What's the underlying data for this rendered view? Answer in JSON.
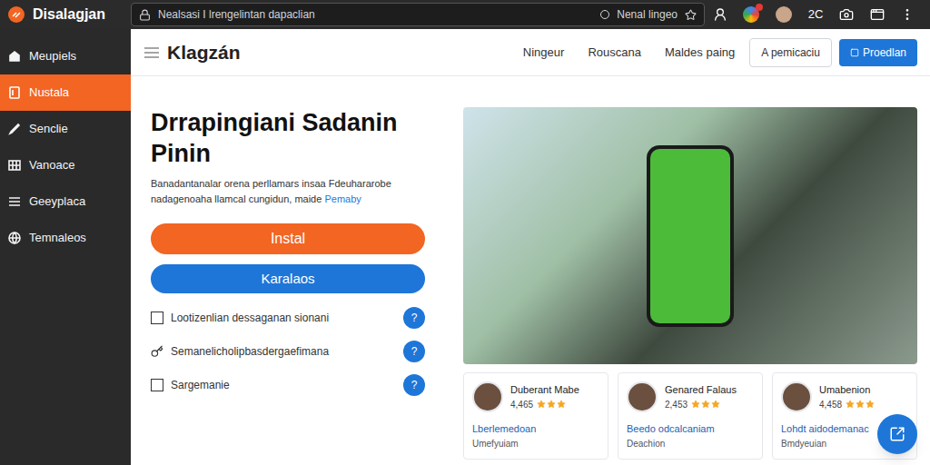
{
  "browser": {
    "title": "Disalagjan",
    "address": "Nealsasi I lrengelintan dapaclian",
    "address_right": "Nenal lingeo",
    "counter": "2C"
  },
  "sidebar": {
    "items": [
      {
        "label": "Meupiels",
        "selected": false
      },
      {
        "label": "Nustala",
        "selected": true
      },
      {
        "label": "Senclie",
        "selected": false
      },
      {
        "label": "Vanoace",
        "selected": false
      },
      {
        "label": "Geeyplaca",
        "selected": false
      },
      {
        "label": "Temnaleos",
        "selected": false
      }
    ]
  },
  "header": {
    "title": "Klagzán",
    "nav": [
      "Ningeur",
      "Rouscana",
      "Maldes paing"
    ],
    "outline_button": "A pemicaciu",
    "primary_button": "Proedlan"
  },
  "hero": {
    "title": "Drrapingiani Sadanin Pinin",
    "description": "Banadantanalar orena perllamars insaa Fdeuhararobe nadagenoaha llamcal cungidun, maide",
    "link": "Pemaby",
    "install_button": "Instal",
    "secondary_button": "Karalaos",
    "options": [
      {
        "kind": "checkbox",
        "checked": false,
        "label": "Lootizenlian dessaganan sionani",
        "help": "?"
      },
      {
        "kind": "key",
        "label": "Semanelicholipbasdergaefimana",
        "help": "?"
      },
      {
        "kind": "checkbox",
        "checked": false,
        "label": "Sargemanie",
        "help": "?"
      }
    ]
  },
  "reviews": [
    {
      "name": "Duberant Mabe",
      "rating": "4,465",
      "stars": 3,
      "title": "Lberlemedoan",
      "subtitle": "Umefyuiam"
    },
    {
      "name": "Genared Falaus",
      "rating": "2,453",
      "stars": 3,
      "title": "Beedo odcalcaniam",
      "subtitle": "Deachion"
    },
    {
      "name": "Umabenion",
      "rating": "4,458",
      "stars": 3,
      "title": "Lohdt aidodemanac",
      "subtitle": "Bmdyeuian"
    }
  ]
}
